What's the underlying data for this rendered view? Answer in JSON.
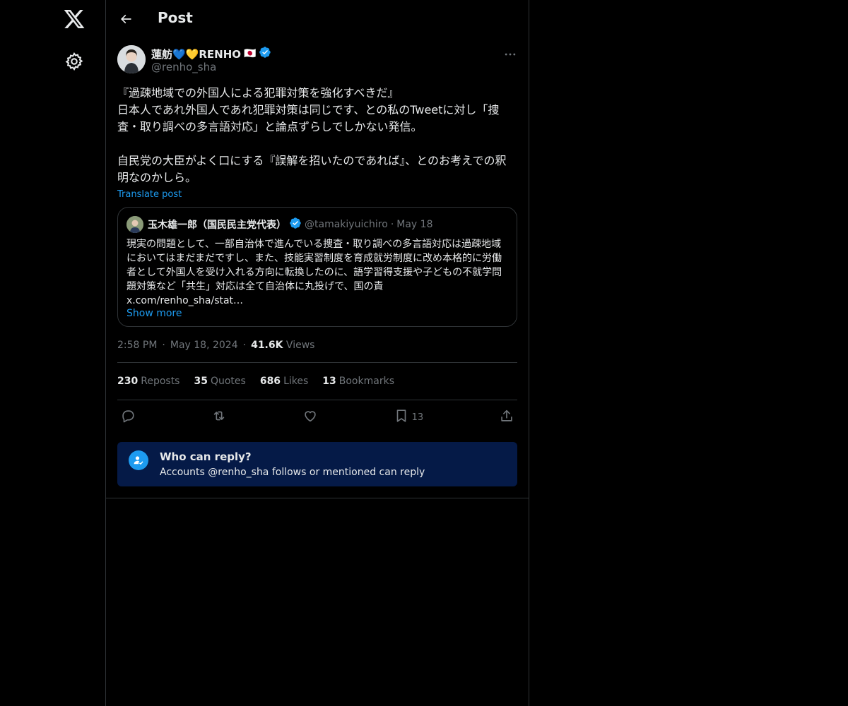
{
  "header": {
    "title": "Post"
  },
  "post": {
    "author_name": "蓮舫💙💛RENHO",
    "author_flag": "🇯🇵",
    "author_handle": "@renho_sha",
    "text": "『過疎地域での外国人による犯罪対策を強化すべきだ』\n日本人であれ外国人であれ犯罪対策は同じです、との私のTweetに対し「捜査・取り調べの多言語対応」と論点ずらしでしかない発信。\n\n自民党の大臣がよく口にする『誤解を招いたのであれば』、とのお考えでの釈明なのかしら。",
    "translate_label": "Translate post",
    "quote": {
      "name": "玉木雄一郎（国民民主党代表）",
      "handle": "@tamakiyuichiro",
      "dot": "·",
      "date": "May 18",
      "text": "現実の問題として、一部自治体で進んでいる捜査・取り調べの多言語対応は過疎地域においてはまだまだですし、また、技能実習制度を育成就労制度に改め本格的に労働者として外国人を受け入れる方向に転換したのに、語学習得支援や子どもの不就学問題対策など「共生」対応は全て自治体に丸投げで、国の責",
      "link": "x.com/renho_sha/stat…",
      "show_more": "Show more"
    },
    "time": "2:58 PM",
    "sep": "·",
    "date": "May 18, 2024",
    "views_count": "41.6K",
    "views_label": "Views",
    "stats": {
      "reposts_count": "230",
      "reposts_label": "Reposts",
      "quotes_count": "35",
      "quotes_label": "Quotes",
      "likes_count": "686",
      "likes_label": "Likes",
      "bookmarks_count": "13",
      "bookmarks_label": "Bookmarks"
    },
    "actions": {
      "bookmark_count": "13"
    },
    "reply": {
      "title": "Who can reply?",
      "subtitle": "Accounts @renho_sha follows or mentioned can reply"
    }
  },
  "colors": {
    "accent": "#1d9bf0",
    "background": "#000000",
    "reply_box": "#051a47"
  },
  "icons": [
    "x-logo-icon",
    "gear-icon",
    "back-arrow-icon",
    "verified-icon",
    "more-icon",
    "reply-icon",
    "repost-icon",
    "like-icon",
    "bookmark-icon",
    "share-icon",
    "person-check-icon"
  ]
}
